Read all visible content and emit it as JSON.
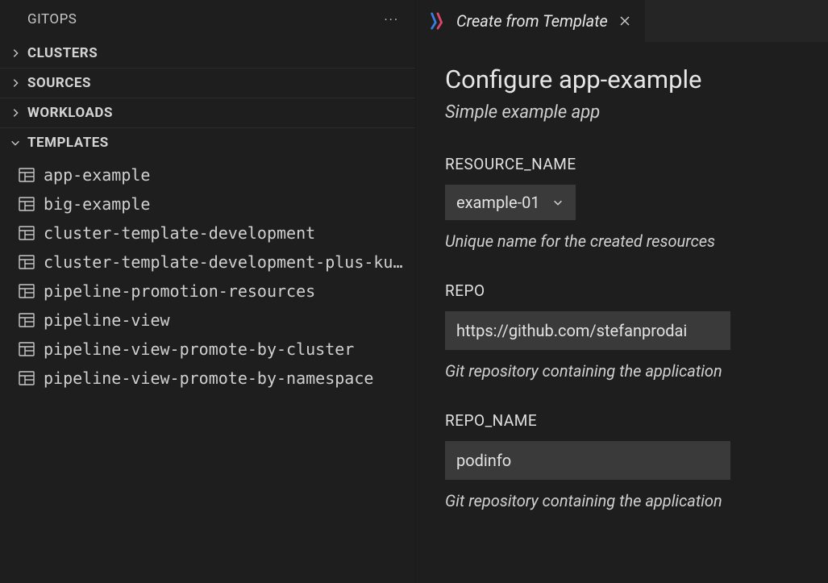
{
  "sidebar": {
    "title": "GITOPS",
    "sections": [
      {
        "label": "CLUSTERS",
        "expanded": false
      },
      {
        "label": "SOURCES",
        "expanded": false
      },
      {
        "label": "WORKLOADS",
        "expanded": false
      },
      {
        "label": "TEMPLATES",
        "expanded": true,
        "items": [
          "app-example",
          "big-example",
          "cluster-template-development",
          "cluster-template-development-plus-kub…",
          "pipeline-promotion-resources",
          "pipeline-view",
          "pipeline-view-promote-by-cluster",
          "pipeline-view-promote-by-namespace"
        ]
      }
    ]
  },
  "tab": {
    "title": "Create from Template"
  },
  "form": {
    "heading": "Configure app-example",
    "subheading": "Simple example app",
    "fields": [
      {
        "label": "RESOURCE_NAME",
        "type": "select",
        "value": "example-01",
        "help": "Unique name for the created resources"
      },
      {
        "label": "REPO",
        "type": "text",
        "value": "https://github.com/stefanprodai",
        "help": "Git repository containing the application"
      },
      {
        "label": "REPO_NAME",
        "type": "text",
        "value": "podinfo",
        "help": "Git repository containing the application"
      }
    ]
  }
}
